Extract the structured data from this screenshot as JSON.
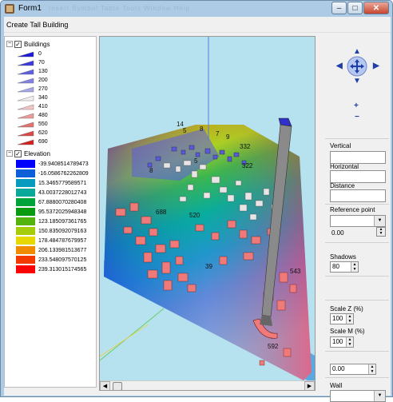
{
  "window": {
    "title": "Form1",
    "menu_ghost": "Insert Symbol Table Tools Window Help",
    "controls": {
      "minimize": "–",
      "maximize": "□",
      "close": "✕"
    }
  },
  "menu": {
    "create_label": "Create Tall Building"
  },
  "legend": {
    "buildings": {
      "label": "Buildings",
      "items": [
        {
          "label": "0",
          "color": "#1c1cd8"
        },
        {
          "label": "70",
          "color": "#3b3bdb"
        },
        {
          "label": "130",
          "color": "#5e5fe0"
        },
        {
          "label": "200",
          "color": "#8182e4"
        },
        {
          "label": "270",
          "color": "#a5a6ea"
        },
        {
          "label": "340",
          "color": "#f2eef2"
        },
        {
          "label": "410",
          "color": "#f2c4c4"
        },
        {
          "label": "480",
          "color": "#ec9a9a"
        },
        {
          "label": "550",
          "color": "#e47070"
        },
        {
          "label": "620",
          "color": "#dc4848"
        },
        {
          "label": "690",
          "color": "#d42020"
        }
      ]
    },
    "elevation": {
      "label": "Elevation",
      "items": [
        {
          "label": "-39.9408514789473",
          "color": "#0000ff"
        },
        {
          "label": "-16.0586762262809",
          "color": "#0d5fd8"
        },
        {
          "label": "15.3465779589571",
          "color": "#089bbe"
        },
        {
          "label": "43.0037228012743",
          "color": "#0aa898"
        },
        {
          "label": "67.8880070280408",
          "color": "#00a33a"
        },
        {
          "label": "95.5372025948348",
          "color": "#079c10"
        },
        {
          "label": "123.185097361765",
          "color": "#54b30c"
        },
        {
          "label": "150.835092079163",
          "color": "#a6cc0a"
        },
        {
          "label": "178.484787679957",
          "color": "#e6d800"
        },
        {
          "label": "206.133981513677",
          "color": "#f28a00"
        },
        {
          "label": "233.548097570125",
          "color": "#f23a00"
        },
        {
          "label": "239.313015174565",
          "color": "#ff0000"
        }
      ]
    }
  },
  "viewport": {
    "labels": [
      "14",
      "5",
      "8",
      "7",
      "9",
      "332",
      "322",
      "5",
      "8",
      "688",
      "520",
      "543",
      "39",
      "592"
    ]
  },
  "panel": {
    "vertical_label": "Vertical",
    "horizontal_label": "Horizontal",
    "distance_label": "Distance",
    "reference_label": "Reference point",
    "reference_value": "0.00",
    "shadows_label": "Shadows",
    "shadows_value": "80",
    "scale_z_label": "Scale Z (%)",
    "scale_z_value": "100",
    "scale_m_label": "Scale M (%)",
    "scale_m_value": "100",
    "offset_value": "0.00",
    "wall_label": "Wall",
    "zoom_in": "+",
    "zoom_out": "−"
  }
}
